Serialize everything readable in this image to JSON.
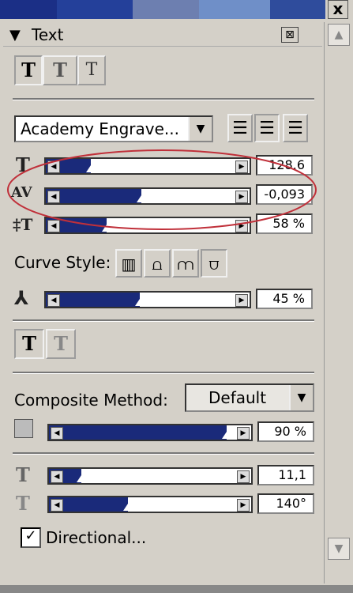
{
  "panel": {
    "title": "Text",
    "close_glyph": "⊠",
    "window_close_glyph": "x"
  },
  "colors": {
    "slider_fill": "#1a2a7a",
    "annotation": "#c0303a",
    "top_strip": [
      "#1b2f86",
      "#24409a",
      "#6d7fb0",
      "#6f8fc8",
      "#2f4c9c"
    ]
  },
  "text_style_buttons": [
    "T",
    "T",
    "T"
  ],
  "font": {
    "name": "Academy Engrave...",
    "dropdown_icon": "triangle-down-icon"
  },
  "align_icons": [
    "align-left-icon",
    "align-center-icon",
    "align-right-icon"
  ],
  "sliders1": [
    {
      "icon": "font-size-icon",
      "glyph": "T",
      "value": "128.6",
      "level": 0.22
    },
    {
      "icon": "kerning-icon",
      "glyph": "AV",
      "value": "-0,093",
      "level": 0.47
    },
    {
      "icon": "leading-icon",
      "glyph": "‡T",
      "value": "58 %",
      "level": 0.3
    }
  ],
  "curve": {
    "label": "Curve Style:",
    "icons": [
      "curve-flat-icon",
      "curve-arch-icon",
      "curve-wave-icon",
      "curve-bulge-icon"
    ]
  },
  "slider_curve": {
    "icon": "curve-amount-icon",
    "glyph": "⅄",
    "value": "45 %",
    "level": 0.46
  },
  "effect_buttons": [
    "T",
    "T"
  ],
  "composite": {
    "label": "Composite Method:",
    "value": "Default",
    "opacity_value": "90 %",
    "opacity_level": 0.88
  },
  "sliders2": [
    {
      "icon": "depth-icon",
      "glyph": "T",
      "value": "11,1",
      "level": 0.16
    },
    {
      "icon": "angle-icon",
      "glyph": "T",
      "value": "140°",
      "level": 0.39
    }
  ],
  "directional": {
    "label": "Directional...",
    "checked": "✓"
  }
}
